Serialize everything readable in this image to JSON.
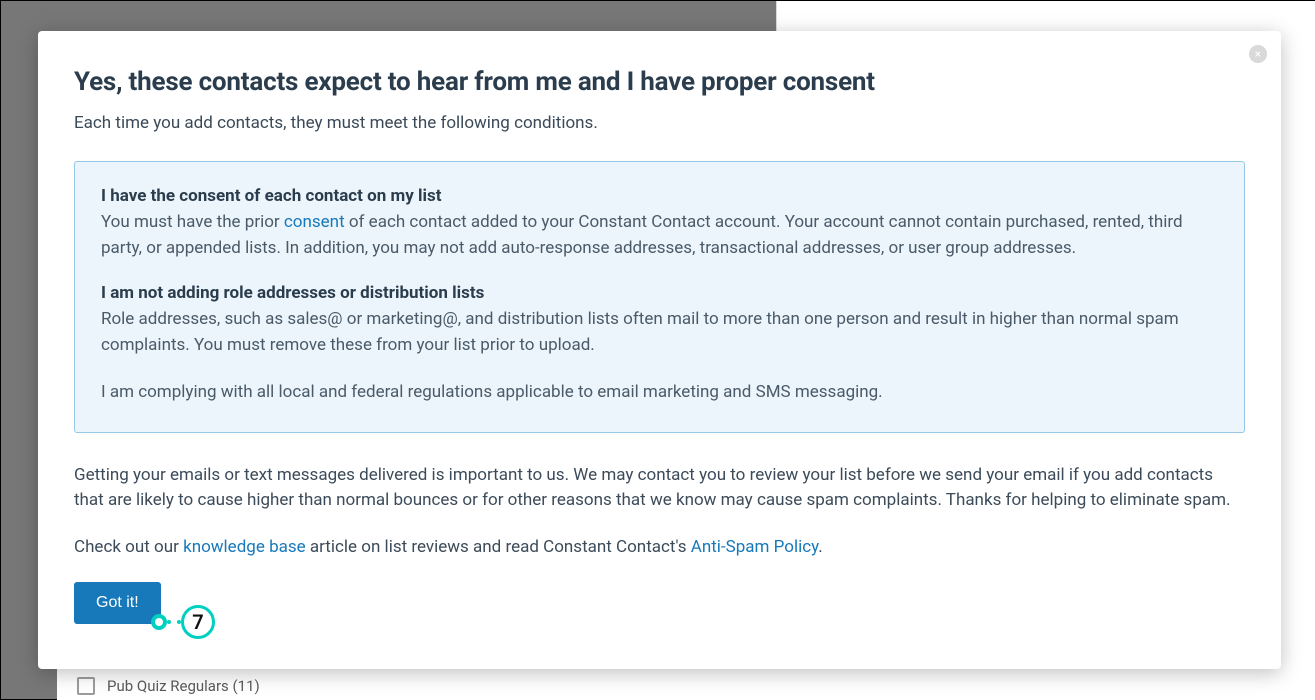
{
  "modal": {
    "title": "Yes, these contacts expect to hear from me and I have proper consent",
    "subtitle": "Each time you add contacts, they must meet the following conditions.",
    "consent_heading": "I have the consent of each contact on my list",
    "consent_text_pre": "You must have the prior ",
    "consent_link": "consent",
    "consent_text_post": " of each contact added to your Constant Contact account. Your account cannot contain purchased, rented, third party, or appended lists. In addition, you may not add auto-response addresses, transactional addresses, or user group addresses.",
    "role_heading": "I am not adding role addresses or distribution lists",
    "role_text": "Role addresses, such as sales@ or marketing@, and distribution lists often mail to more than one person and result in higher than normal spam complaints. You must remove these from your list prior to upload.",
    "comply_text": "I am complying with all local and federal regulations applicable to email marketing and SMS messaging.",
    "delivery_text": "Getting your emails or text messages delivered is important to us. We may contact you to review your list before we send your email if you add contacts that are likely to cause higher than normal bounces or for other reasons that we know may cause spam complaints. Thanks for helping to eliminate spam.",
    "checkout_pre": "Check out our ",
    "kb_link": "knowledge base",
    "checkout_mid": " article on list reviews and read Constant Contact's ",
    "antispam_link": "Anti-Spam Policy",
    "checkout_post": ".",
    "gotit_label": "Got it!",
    "close_glyph": "×"
  },
  "background": {
    "list_item_label": "Pub Quiz Regulars (11)"
  },
  "annotation": {
    "step_number": "7"
  }
}
